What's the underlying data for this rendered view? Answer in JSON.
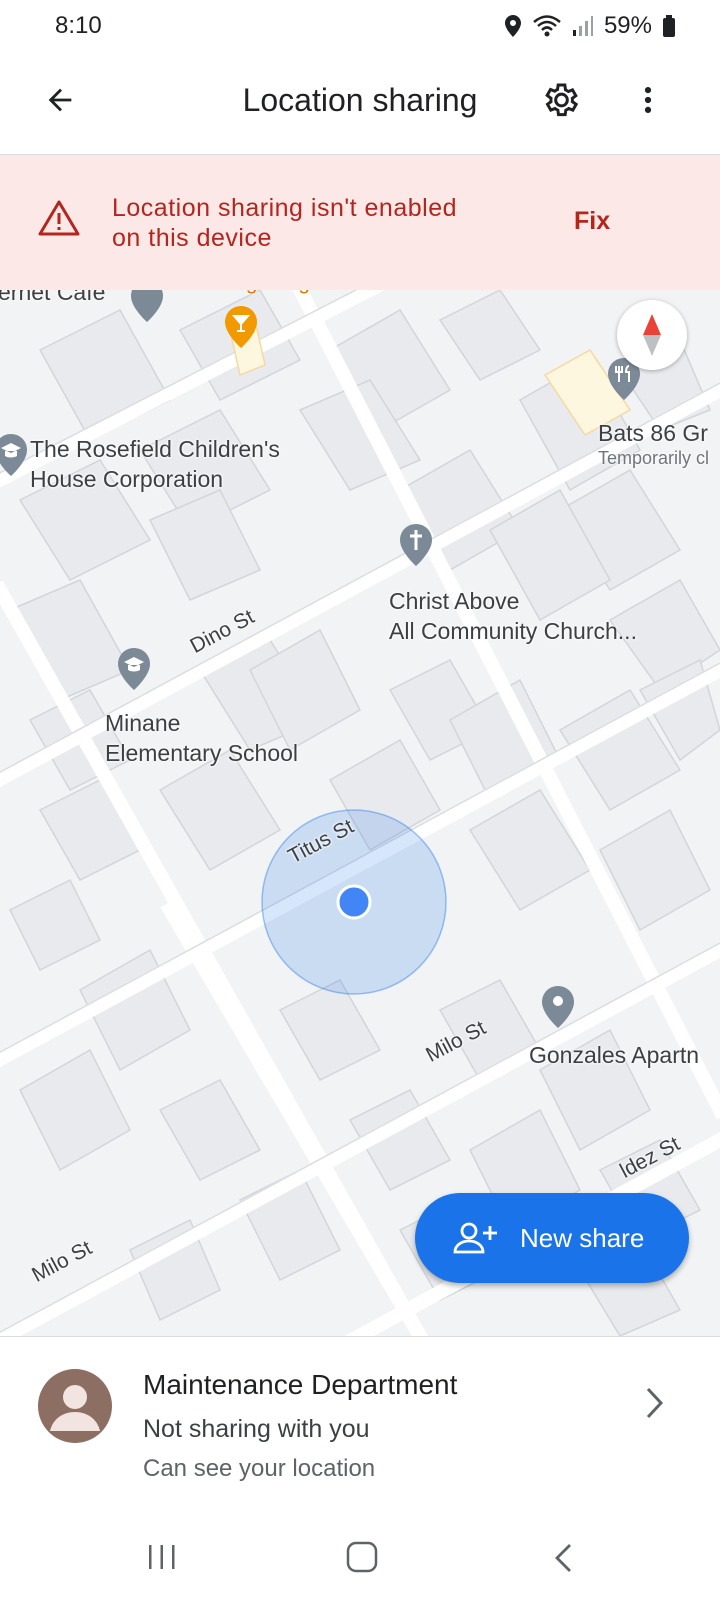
{
  "status_bar": {
    "time": "8:10",
    "battery": "59%"
  },
  "app_bar": {
    "title": "Location sharing"
  },
  "banner": {
    "message_line1": "Location sharing isn't enabled",
    "message_line2": "on this device",
    "fix_label": "Fix"
  },
  "map": {
    "places": {
      "internet_cafe": "ernet Cafe",
      "ilang_street": "Ilang-Ilang Street",
      "rosefield_line1": "The Rosefield Children's",
      "rosefield_line2": "House Corporation",
      "bats_name": "Bats 86 Gr",
      "bats_status": "Temporarily cl",
      "church_line1": "Christ Above",
      "church_line2": "All Community Church...",
      "school_line1": "Minane",
      "school_line2": "Elementary School",
      "gonzales": "Gonzales Apartn"
    },
    "streets": {
      "dino": "Dino St",
      "titus": "Titus St",
      "milo_1": "Milo St",
      "milo_2": "Milo St",
      "valdez": "ldez St"
    }
  },
  "fab": {
    "label": "New share"
  },
  "contact": {
    "name": "Maintenance Department",
    "status": "Not sharing with you",
    "subtitle": "Can see your location"
  },
  "colors": {
    "accent": "#1a73e8",
    "banner_bg": "#fce8e6",
    "banner_text": "#b3261e"
  }
}
